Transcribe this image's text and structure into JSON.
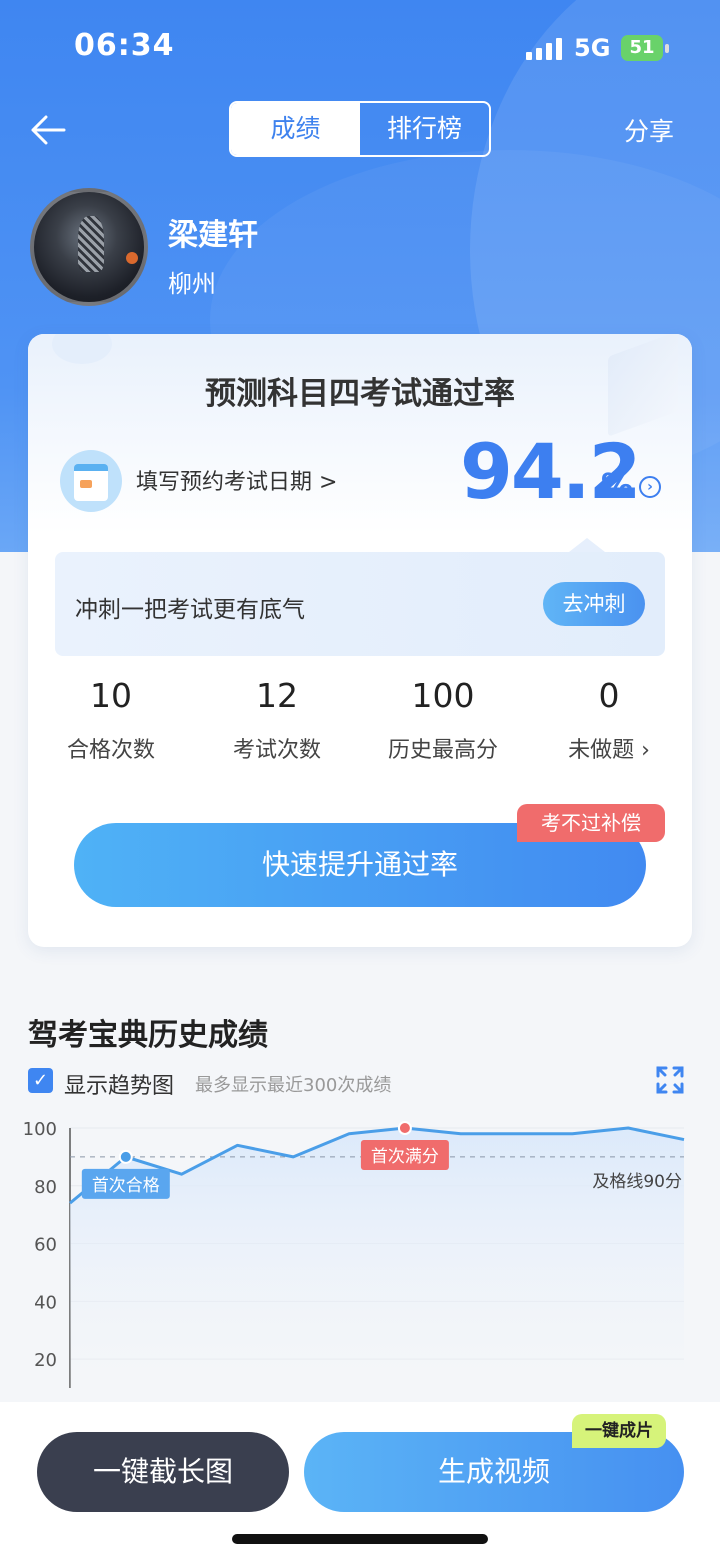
{
  "status_bar": {
    "time": "06:34",
    "network": "5G",
    "battery": "51"
  },
  "header": {
    "tabs": [
      {
        "label": "成绩",
        "active": true
      },
      {
        "label": "排行榜",
        "active": false
      }
    ],
    "share_label": "分享",
    "back_icon": "arrow-left-icon"
  },
  "user": {
    "name": "梁建轩",
    "city": "柳州"
  },
  "pass_card": {
    "title": "预测科目四考试通过率",
    "fill_date_label": "填写预约考试日期 >",
    "rate_value": "94.2",
    "rate_unit": "%",
    "sprint_text": "冲刺一把考试更有底气",
    "sprint_button": "去冲刺",
    "stats": [
      {
        "value": "10",
        "label": "合格次数"
      },
      {
        "value": "12",
        "label": "考试次数"
      },
      {
        "value": "100",
        "label": "历史最高分"
      },
      {
        "value": "0",
        "label": "未做题 ›"
      }
    ],
    "boost_button": "快速提升通过率",
    "guarantee_badge": "考不过补偿"
  },
  "history": {
    "title": "驾考宝典历史成绩",
    "show_trend_label": "显示趋势图",
    "trend_checked": true,
    "hint": "最多显示最近300次成绩"
  },
  "chart_data": {
    "type": "line",
    "yticks": [
      "100",
      "80",
      "60",
      "40",
      "20"
    ],
    "ylim": [
      10,
      100
    ],
    "x": [
      1,
      2,
      3,
      4,
      5,
      6,
      7,
      8,
      9,
      10,
      11,
      12
    ],
    "values": [
      74,
      90,
      84,
      94,
      90,
      98,
      100,
      98,
      98,
      98,
      100,
      96
    ],
    "pass_line": 90,
    "pass_line_label": "及格线90分",
    "first_pass_label": "首次合格",
    "first_pass_index": 1,
    "first_full_label": "首次满分",
    "first_full_index": 6,
    "colors": {
      "line": "#4a9ee8",
      "full_marker": "#f06c6c",
      "pass_tag": "#5aa6ef",
      "full_tag": "#f06c6c"
    }
  },
  "bottom_bar": {
    "screenshot_button": "一键截长图",
    "video_button": "生成视频",
    "video_badge": "一键成片"
  }
}
